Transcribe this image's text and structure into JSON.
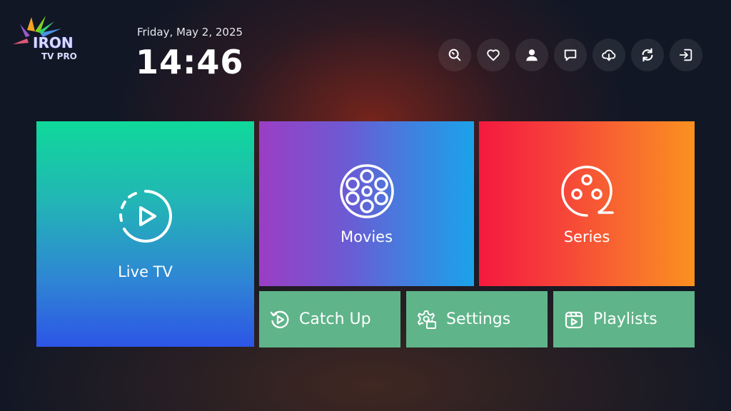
{
  "app": {
    "logo_text": "IRON",
    "logo_sub": "TV PRO"
  },
  "header": {
    "date": "Friday, May 2, 2025",
    "time": "14:46"
  },
  "toolbar": {
    "buttons": [
      {
        "icon": "search-icon"
      },
      {
        "icon": "heart-icon"
      },
      {
        "icon": "user-icon"
      },
      {
        "icon": "chat-icon"
      },
      {
        "icon": "download-icon"
      },
      {
        "icon": "refresh-icon"
      },
      {
        "icon": "logout-icon"
      }
    ]
  },
  "tiles": {
    "live_tv": {
      "label": "Live TV",
      "icon": "play-circle-icon"
    },
    "movies": {
      "label": "Movies",
      "icon": "film-reel-icon"
    },
    "series": {
      "label": "Series",
      "icon": "film-reel-icon"
    },
    "catch_up": {
      "label": "Catch Up",
      "icon": "replay-icon"
    },
    "settings": {
      "label": "Settings",
      "icon": "settings-icon"
    },
    "playlists": {
      "label": "Playlists",
      "icon": "playlist-icon"
    }
  },
  "colors": {
    "background": "#121725",
    "small_tile": "#5fb489",
    "live_tv_gradient": [
      "#0fd99a",
      "#2d55e6"
    ],
    "movies_gradient": [
      "#9b3ec4",
      "#1aa3ea"
    ],
    "series_gradient": [
      "#f5193f",
      "#fb911f"
    ]
  }
}
